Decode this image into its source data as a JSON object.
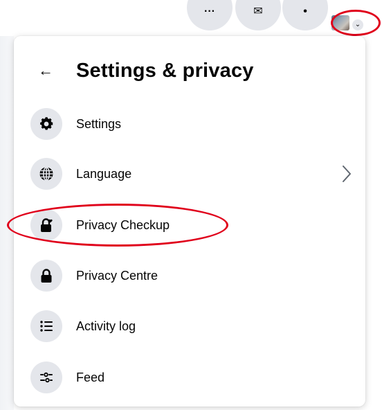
{
  "panel": {
    "title": "Settings & privacy",
    "items": [
      {
        "label": "Settings",
        "icon": "gear-icon",
        "has_submenu": false
      },
      {
        "label": "Language",
        "icon": "globe-icon",
        "has_submenu": true
      },
      {
        "label": "Privacy Checkup",
        "icon": "lock-heart-icon",
        "has_submenu": false
      },
      {
        "label": "Privacy Centre",
        "icon": "lock-icon",
        "has_submenu": false
      },
      {
        "label": "Activity log",
        "icon": "list-icon",
        "has_submenu": false
      },
      {
        "label": "Feed",
        "icon": "sliders-icon",
        "has_submenu": false
      }
    ]
  },
  "annotations": {
    "color": "#e0001b"
  },
  "colors": {
    "icon_bg": "#e4e6eb",
    "text": "#050505"
  }
}
